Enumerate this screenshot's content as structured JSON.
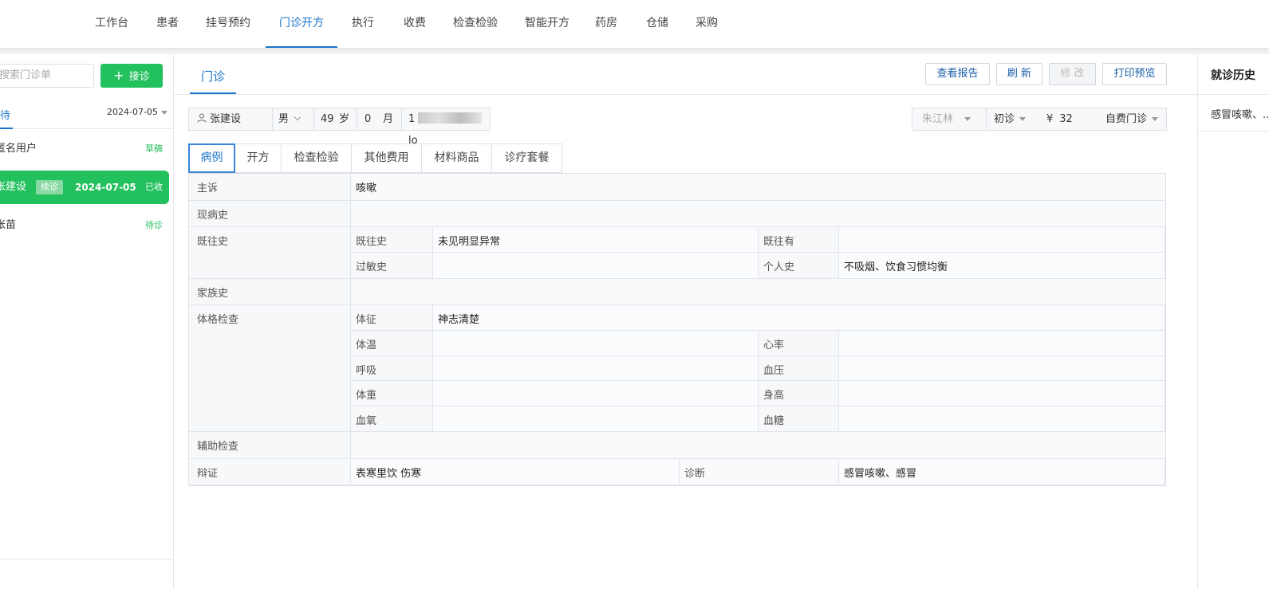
{
  "nav": {
    "items": [
      "工作台",
      "患者",
      "挂号预约",
      "门诊开方",
      "执行",
      "收费",
      "检查检验",
      "智能开方",
      "药房",
      "仓储",
      "采购"
    ],
    "active": "门诊开方"
  },
  "left_panel": {
    "search_placeholder": "搜索门诊单",
    "jiezhen_label": "接诊",
    "tab_label": "待",
    "date_filter": "2024-07-05",
    "patients": [
      {
        "name": "匿名用户",
        "status": "草稿"
      },
      {
        "name": "张建设",
        "badge": "续诊",
        "date": "2024-07-05",
        "status": "已收"
      },
      {
        "name": "张苗",
        "status": "待诊"
      }
    ]
  },
  "main": {
    "tab": "门诊",
    "buttons": {
      "report": "查看报告",
      "refresh": "刷 新",
      "edit": "修 改",
      "print": "打印预览"
    },
    "patient": {
      "name": "张建设",
      "gender": "男",
      "age": "49",
      "age_unit": "岁",
      "months": "0",
      "month_unit": "月",
      "phone_prefix": "1",
      "phone_suffix": "lo"
    },
    "visit": {
      "doctor": "朱江林",
      "visit_type": "初诊",
      "currency": "¥",
      "fee": "32",
      "pay_type": "自费门诊"
    },
    "subtabs": [
      "病例",
      "开方",
      "检查检验",
      "其他费用",
      "材料商品",
      "诊疗套餐"
    ],
    "record": {
      "chief_complaint_label": "主诉",
      "chief_complaint": "咳嗽",
      "present_illness_label": "现病史",
      "present_illness": "",
      "past_history_label": "既往史",
      "past_history_sub_label": "既往史",
      "past_history_value": "未见明显异常",
      "past_has_label": "既往有",
      "past_has_value": "",
      "allergy_label": "过敏史",
      "allergy_value": "",
      "personal_label": "个人史",
      "personal_value": "不吸烟、饮食习惯均衡",
      "family_label": "家族史",
      "family_value": "",
      "physical_label": "体格检查",
      "signs_label": "体征",
      "signs_value": "神志清楚",
      "temp_label": "体温",
      "heart_label": "心率",
      "resp_label": "呼吸",
      "bp_label": "血压",
      "weight_label": "体重",
      "height_label": "身高",
      "oxygen_label": "血氧",
      "glucose_label": "血糖",
      "aux_label": "辅助检查",
      "aux_value": "",
      "syndrome_label": "辩证",
      "syndrome_value": "表寒里饮 伤寒",
      "diagnosis_label": "诊断",
      "diagnosis_value": "感冒咳嗽、感冒"
    }
  },
  "right_panel": {
    "title": "就诊历史",
    "item": "感冒咳嗽、..."
  }
}
